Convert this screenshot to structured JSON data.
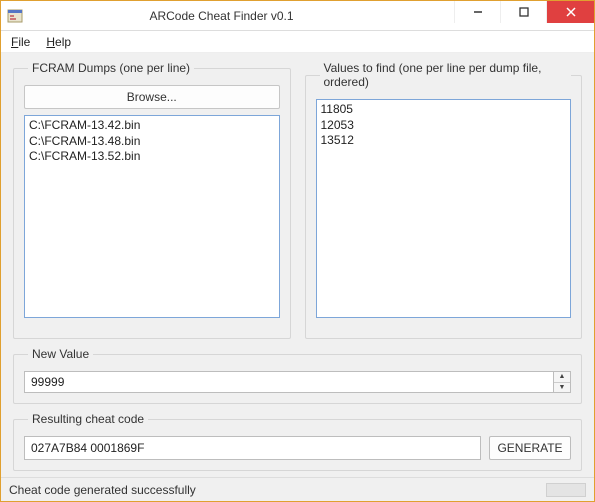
{
  "window": {
    "title": "ARCode Cheat Finder v0.1"
  },
  "menu": {
    "file": "File",
    "help": "Help"
  },
  "dumps": {
    "legend": "FCRAM Dumps (one per line)",
    "browse_label": "Browse...",
    "value": "C:\\FCRAM-13.42.bin\nC:\\FCRAM-13.48.bin\nC:\\FCRAM-13.52.bin"
  },
  "values": {
    "legend": "Values to find (one per line per dump file, ordered)",
    "value": "11805\n12053\n13512"
  },
  "newvalue": {
    "legend": "New Value",
    "value": "99999"
  },
  "result": {
    "legend": "Resulting cheat code",
    "value": "027A7B84 0001869F",
    "generate_label": "GENERATE"
  },
  "status": {
    "text": "Cheat code generated successfully"
  }
}
